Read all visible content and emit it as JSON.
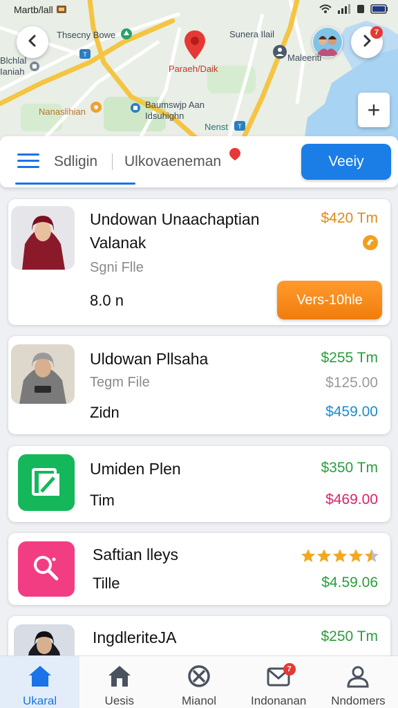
{
  "status_bar": {
    "carrier": "Martb/lall"
  },
  "map": {
    "labels": {
      "place_1": "Thsecny Bowe",
      "place_2": "Sunera Ilail",
      "place_3": "Maleeriti",
      "place_4": "Blchlal",
      "place_5": "Ianiah",
      "pin_label": "Paraeh/Daik",
      "place_6": "Baumswjp Aan",
      "place_7": "Idsuhighn",
      "place_8": "Nanaslihian",
      "place_9": "Nenst"
    },
    "notification_count": "7",
    "zoom_in_label": "+"
  },
  "toolbar": {
    "tab_1": "Sdligin",
    "tab_2": "Ulkovaeneman",
    "view_button": "Veeiy"
  },
  "list": [
    {
      "title_line1": "Undowan Unaachaptian",
      "title_line2": "Valanak",
      "subtitle": "Sgni Flle",
      "value": "8.0 n",
      "price": "$420 Tm",
      "action_button": "Vers-10hle"
    },
    {
      "title": "Uldowan Pllsaha",
      "subtitle": "Tegm File",
      "value": "Zidn",
      "price_1": "$255 Tm",
      "price_2": "$125.00",
      "price_3": "$459.00"
    },
    {
      "title": "Umiden Plen",
      "value": "Tim",
      "price_1": "$350 Tm",
      "price_2": "$469.00"
    },
    {
      "title": "Saftian lleys",
      "value": "Tille",
      "rating": 4.5,
      "price": "$4.59.06"
    },
    {
      "title": "IngdleriteJA",
      "price": "$250 Tm"
    }
  ],
  "bottom_nav": [
    {
      "label": "Ukaral",
      "icon": "home-icon",
      "active": true
    },
    {
      "label": "Uesis",
      "icon": "home-outline-icon"
    },
    {
      "label": "Mianol",
      "icon": "circle-x-icon"
    },
    {
      "label": "Indonanan",
      "icon": "mail-icon",
      "badge": "7"
    },
    {
      "label": "Nndomers",
      "icon": "person-icon"
    }
  ],
  "colors": {
    "accent": "#1a7ee6",
    "orange": "#f07d0c",
    "green": "#2a9d3c",
    "pink": "#d6246e",
    "blue_price": "#1b8bd0"
  }
}
